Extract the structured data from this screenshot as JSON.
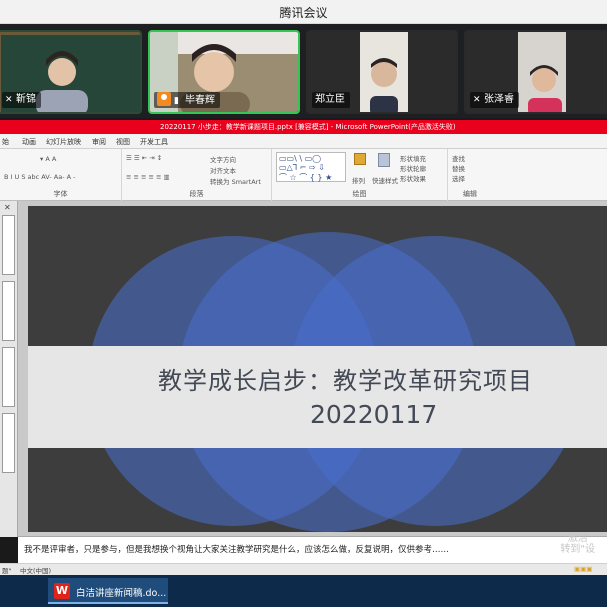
{
  "app": {
    "title": "腾讯会议"
  },
  "participants": [
    {
      "name": "靳锦",
      "muted": true
    },
    {
      "name": "毕春辉",
      "muted": false,
      "speaking": true
    },
    {
      "name": "郑立臣",
      "muted": false
    },
    {
      "name": "张泽睿",
      "muted": true
    }
  ],
  "ppt": {
    "window_title": "20220117 小步走：教学新课题项目.pptx [兼容模式] - Microsoft PowerPoint(产品激活失败)",
    "tabs": [
      "始",
      "动画",
      "幻灯片放映",
      "审阅",
      "视图",
      "开发工具"
    ],
    "groups": [
      "字体",
      "段落",
      "绘图",
      "编辑"
    ],
    "paragraph_items": [
      "文字方向",
      "对齐文本",
      "转换为 SmartArt"
    ],
    "drawing_items": [
      "排列",
      "快速样式",
      "形状填充",
      "形状轮廓",
      "形状效果"
    ],
    "edit_items": [
      "查找",
      "替换",
      "选择"
    ]
  },
  "slide": {
    "line1": "教学成长启步：教学改革研究项目",
    "line2": "20220117"
  },
  "notes": {
    "text": "我不是评审者，只是参与，但是我想换个视角让大家关注教学研究是什么，应该怎么做，反复说明，仅供参考……",
    "watermark": "激活\n转到\"设"
  },
  "status": {
    "left": "题\"",
    "lang": "中文(中国)"
  },
  "taskbar": {
    "item": "白洁讲座新闻稿.do..."
  },
  "colors": {
    "accent_red": "#e8001c",
    "speaking_border": "#33c653",
    "slide_bg": "#3d3d3e",
    "circle_blue": "#4870cd"
  }
}
